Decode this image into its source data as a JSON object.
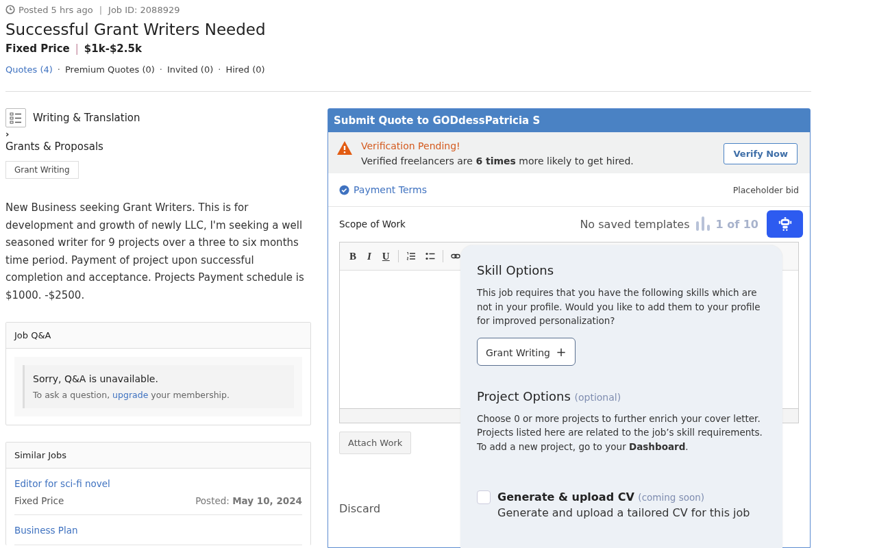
{
  "meta": {
    "posted": "Posted 5 hrs ago",
    "separator": "|",
    "job_id": "Job ID: 2088929"
  },
  "title": "Successful Grant Writers Needed",
  "price": {
    "type": "Fixed Price",
    "separator": "|",
    "range": "$1k-$2.5k"
  },
  "stats": [
    {
      "label": "Quotes (4)",
      "selected": true
    },
    {
      "label": "Premium Quotes (0)",
      "selected": false
    },
    {
      "label": "Invited (0)",
      "selected": false
    },
    {
      "label": "Hired (0)",
      "selected": false
    }
  ],
  "stats_separator": "·",
  "category": {
    "name": "Writing & Translation",
    "chevron": "›",
    "subcategory": "Grants & Proposals"
  },
  "skills": [
    "Grant Writing"
  ],
  "description": "New Business seeking Grant Writers. This is for development and growth of newly LLC,  I'm seeking a well seasoned writer for 9 projects over a three to six months time period.  Payment of project upon successful completion and acceptance. Projects Payment schedule is $1000. -$2500.",
  "qa": {
    "title": "Job Q&A",
    "heading": "Sorry, Q&A is unavailable.",
    "text_before": "To ask a question,",
    "link": "upgrade",
    "text_after": "your membership."
  },
  "similar_jobs": {
    "title": "Similar Jobs",
    "items": [
      {
        "title": "Editor for sci-fi novel",
        "price_type": "Fixed Price",
        "posted": "Posted: **May 10, 2024**"
      },
      {
        "title": "Business Plan"
      }
    ]
  },
  "quote": {
    "title": "Submit Quote to GODdessPatricia S",
    "alert": {
      "title": "Verification Pending!",
      "text": "Verified freelancers are **6 times** more likely to get hired.",
      "button": "Verify Now"
    },
    "payment_terms": "Payment Terms",
    "bid": "Placeholder bid",
    "scope_label": "Scope of Work",
    "templates": "No saved templates",
    "counter": "1 of 10",
    "toolbar": [
      {
        "kind": "bold",
        "label": "B"
      },
      {
        "kind": "italic",
        "label": "I"
      },
      {
        "kind": "underline",
        "label": "U"
      },
      {
        "kind": "ordered"
      },
      {
        "kind": "bullets"
      },
      {
        "kind": "link"
      }
    ],
    "attach": "Attach Work",
    "discard": "Discard"
  },
  "popover": {
    "skill_title": "Skill Options",
    "skill_text": "This job requires that you have the following skills which are not in your profile. Would you like to add them to your profile for improved personalization?",
    "skills": [
      {
        "label": "Grant Writing",
        "plus": "+"
      }
    ],
    "project_title": "Project Options",
    "project_note": "(optional)",
    "project_text": "Choose 0 or more projects to further enrich your cover letter. Projects listed here are related to the job’s skill requirements. To add a new project, go to your **Dashboard**.",
    "cv": {
      "checked": false,
      "title": "Generate & upload CV",
      "note": "(coming soon)",
      "text": "Generate and upload a tailored CV for this job"
    }
  }
}
